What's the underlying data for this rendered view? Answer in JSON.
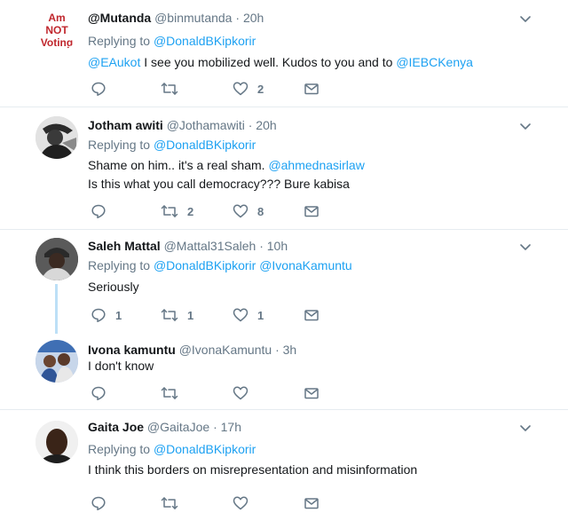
{
  "tweets": [
    {
      "name": "@Mutanda",
      "handle": "@binmutanda",
      "time": "20h",
      "replying_label": "Replying to",
      "replying_to": [
        "@DonaldBKipkorir"
      ],
      "avatar_text": [
        "Am",
        "NOT",
        "Voting"
      ],
      "lines": [
        [
          {
            "t": "@EAukot",
            "link": true
          },
          {
            "t": " I see you mobilized well. Kudos to you and to "
          },
          {
            "t": "@IEBCKenya",
            "link": true
          }
        ]
      ],
      "counts": {
        "reply": "",
        "retweet": "",
        "like": "2"
      }
    },
    {
      "name": "Jotham awiti",
      "handle": "@Jothamawiti",
      "time": "20h",
      "replying_label": "Replying to",
      "replying_to": [
        "@DonaldBKipkorir"
      ],
      "lines": [
        [
          {
            "t": "Shame on him.. it's a real sham. "
          },
          {
            "t": "@ahmednasirlaw",
            "link": true
          }
        ],
        [
          {
            "t": "Is this what you call democracy??? Bure kabisa"
          }
        ]
      ],
      "counts": {
        "reply": "",
        "retweet": "2",
        "like": "8"
      }
    },
    {
      "name": "Saleh Mattal",
      "handle": "@Mattal31Saleh",
      "time": "10h",
      "replying_label": "Replying to",
      "replying_to": [
        "@DonaldBKipkorir",
        "@IvonaKamuntu"
      ],
      "lines": [
        [
          {
            "t": "Seriously"
          }
        ]
      ],
      "counts": {
        "reply": "1",
        "retweet": "1",
        "like": "1"
      }
    },
    {
      "name": "Ivona kamuntu",
      "handle": "@IvonaKamuntu",
      "time": "3h",
      "lines": [
        [
          {
            "t": "I don't know"
          }
        ]
      ],
      "counts": {
        "reply": "",
        "retweet": "",
        "like": ""
      }
    },
    {
      "name": "Gaita Joe",
      "handle": "@GaitaJoe",
      "time": "17h",
      "replying_label": "Replying to",
      "replying_to": [
        "@DonaldBKipkorir"
      ],
      "lines": [
        [
          {
            "t": "I think this borders on misrepresentation and misinformation"
          }
        ]
      ]
    }
  ],
  "colors": {
    "link": "#1da1f2",
    "muted": "#657786",
    "avatar_red": "#c0272d",
    "thread_line": "#bde0f7"
  },
  "icons": {
    "reply": "reply-icon",
    "retweet": "retweet-icon",
    "like": "heart-icon",
    "dm": "envelope-icon",
    "menu": "chevron-down-icon"
  }
}
